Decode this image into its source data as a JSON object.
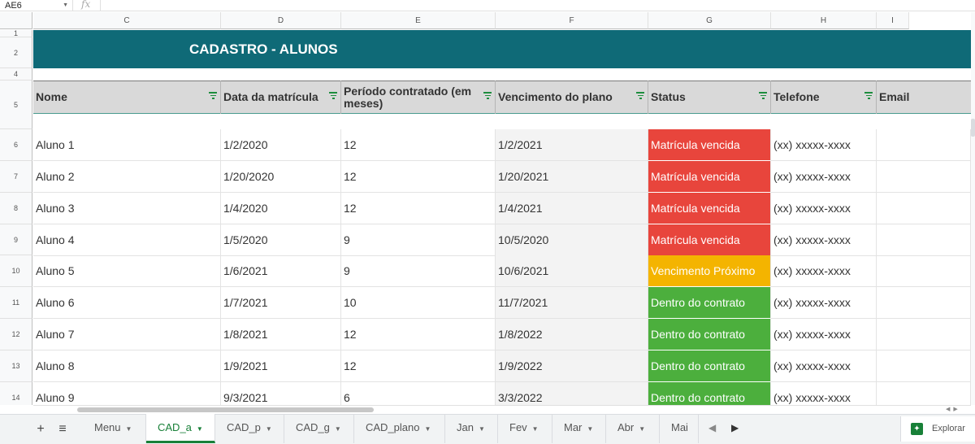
{
  "formula_bar": {
    "cell_ref": "AE6",
    "fx_label": "fx",
    "value": ""
  },
  "columns": [
    "C",
    "D",
    "E",
    "F",
    "G",
    "H",
    "I"
  ],
  "rows": [
    "1",
    "2",
    "4",
    "5",
    "6",
    "7",
    "8",
    "9",
    "10",
    "11",
    "12",
    "13",
    "14"
  ],
  "title": "CADASTRO - ALUNOS",
  "headers": [
    "Nome",
    "Data da matrícula",
    "Período contratado (em meses)",
    "Vencimento do plano",
    "Status",
    "Telefone",
    "Email"
  ],
  "students": [
    {
      "nome": "Aluno 1",
      "data": "1/2/2020",
      "periodo": "12",
      "vencimento": "1/2/2021",
      "status": "Matrícula vencida",
      "telefone": "(xx) xxxxx-xxxx",
      "email": ""
    },
    {
      "nome": "Aluno 2",
      "data": "1/20/2020",
      "periodo": "12",
      "vencimento": "1/20/2021",
      "status": "Matrícula vencida",
      "telefone": "(xx) xxxxx-xxxx",
      "email": ""
    },
    {
      "nome": "Aluno 3",
      "data": "1/4/2020",
      "periodo": "12",
      "vencimento": "1/4/2021",
      "status": "Matrícula vencida",
      "telefone": "(xx) xxxxx-xxxx",
      "email": ""
    },
    {
      "nome": "Aluno 4",
      "data": "1/5/2020",
      "periodo": "9",
      "vencimento": "10/5/2020",
      "status": "Matrícula vencida",
      "telefone": "(xx) xxxxx-xxxx",
      "email": ""
    },
    {
      "nome": "Aluno 5",
      "data": "1/6/2021",
      "periodo": "9",
      "vencimento": "10/6/2021",
      "status": "Vencimento Próximo",
      "telefone": "(xx) xxxxx-xxxx",
      "email": ""
    },
    {
      "nome": "Aluno 6",
      "data": "1/7/2021",
      "periodo": "10",
      "vencimento": "11/7/2021",
      "status": "Dentro do contrato",
      "telefone": "(xx) xxxxx-xxxx",
      "email": ""
    },
    {
      "nome": "Aluno 7",
      "data": "1/8/2021",
      "periodo": "12",
      "vencimento": "1/8/2022",
      "status": "Dentro do contrato",
      "telefone": "(xx) xxxxx-xxxx",
      "email": ""
    },
    {
      "nome": "Aluno 8",
      "data": "1/9/2021",
      "periodo": "12",
      "vencimento": "1/9/2022",
      "status": "Dentro do contrato",
      "telefone": "(xx) xxxxx-xxxx",
      "email": ""
    },
    {
      "nome": "Aluno 9",
      "data": "9/3/2021",
      "periodo": "6",
      "vencimento": "3/3/2022",
      "status": "Dentro do contrato",
      "telefone": "(xx) xxxxx-xxxx",
      "email": ""
    }
  ],
  "status_colors": {
    "Matrícula vencida": "#e8453c",
    "Vencimento Próximo": "#f4b400",
    "Dentro do contrato": "#4caf3d"
  },
  "colors": {
    "title_band": "#0f6a77",
    "accent": "#188038"
  },
  "tabs": {
    "add_icon": "+",
    "menu_icon": "≡",
    "items": [
      "Menu",
      "CAD_a",
      "CAD_p",
      "CAD_g",
      "CAD_plano",
      "Jan",
      "Fev",
      "Mar",
      "Abr",
      "Mai"
    ],
    "active": "CAD_a",
    "explore_label": "Explorar"
  }
}
